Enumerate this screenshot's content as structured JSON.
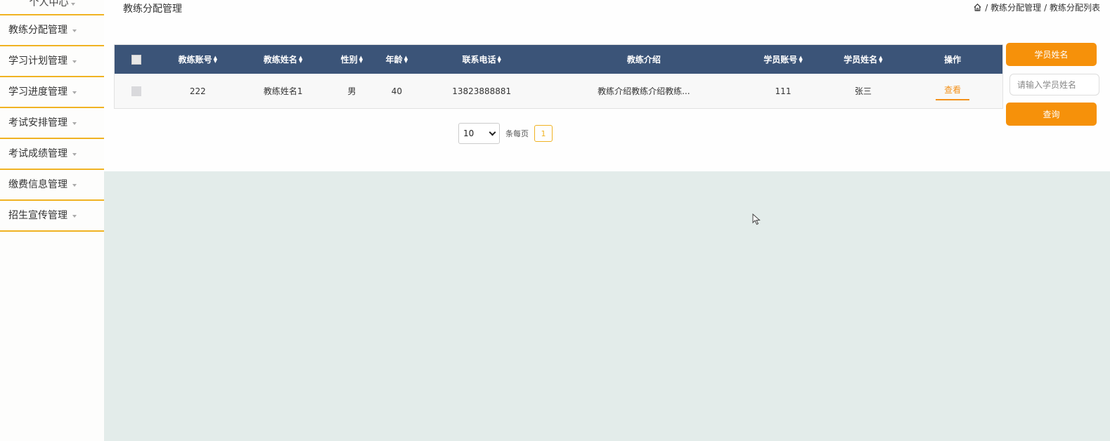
{
  "sidebar": {
    "top_label": "个人中心",
    "items": [
      {
        "label": "教练分配管理"
      },
      {
        "label": "学习计划管理"
      },
      {
        "label": "学习进度管理"
      },
      {
        "label": "考试安排管理"
      },
      {
        "label": "考试成绩管理"
      },
      {
        "label": "缴费信息管理"
      },
      {
        "label": "招生宣传管理"
      }
    ]
  },
  "header": {
    "title": "教练分配管理",
    "breadcrumb": [
      "/ 教练分配管理",
      "/ 教练分配列表"
    ]
  },
  "table": {
    "columns": [
      "教练账号",
      "教练姓名",
      "性别",
      "年龄",
      "联系电话",
      "教练介绍",
      "学员账号",
      "学员姓名",
      "操作"
    ],
    "rows": [
      {
        "coach_account": "222",
        "coach_name": "教练姓名1",
        "gender": "男",
        "age": "40",
        "phone": "13823888881",
        "intro": "教练介绍教练介绍教练...",
        "student_account": "111",
        "student_name": "张三",
        "action": "查看"
      }
    ]
  },
  "pagination": {
    "page_size": "10",
    "per_page_label": "条每页",
    "current_page": "1"
  },
  "search": {
    "label": "学员姓名",
    "placeholder": "请输入学员姓名",
    "button": "查询"
  },
  "colors": {
    "accent": "#f6910a",
    "table_header": "#3b5478",
    "menu_border": "#f0b323",
    "background": "#e3ecea"
  }
}
